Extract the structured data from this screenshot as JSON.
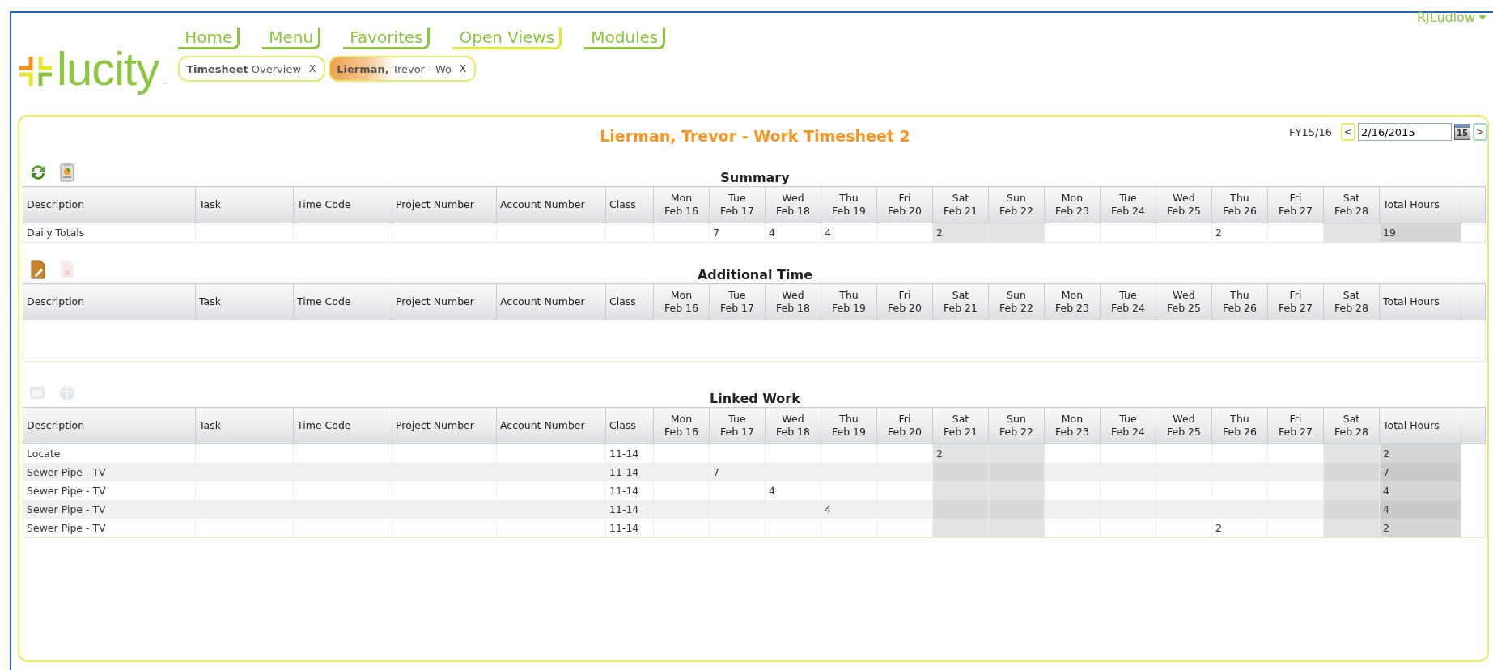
{
  "user": {
    "name": "RJLudlow"
  },
  "logo": {
    "text": "lucity",
    "mark": "™"
  },
  "nav": [
    {
      "label": "Home",
      "selected": false
    },
    {
      "label": "Menu",
      "selected": false
    },
    {
      "label": "Favorites",
      "selected": false
    },
    {
      "label": "Open Views",
      "selected": true
    },
    {
      "label": "Modules",
      "selected": false
    }
  ],
  "open_tabs": [
    {
      "label": "**Timesheet** Overview",
      "close": "X",
      "selected": false
    },
    {
      "label": "**Lierman,** Trevor  - Wo",
      "close": "X",
      "selected": true
    }
  ],
  "page": {
    "title": "Lierman, Trevor  - Work Timesheet 2",
    "fiscal_year": "FY15/16",
    "prev": "<",
    "date": "2/16/2015",
    "calendar_day": "15",
    "next": ">"
  },
  "sections": [
    {
      "title": "Summary",
      "tools": [
        {
          "kind": "refresh",
          "disabled": false
        },
        {
          "kind": "report",
          "disabled": false
        }
      ],
      "columns": [
        {
          "kind": "text",
          "label": "Description"
        },
        {
          "kind": "text",
          "label": "Task"
        },
        {
          "kind": "text",
          "label": "Time Code"
        },
        {
          "kind": "text",
          "label": "Project Number"
        },
        {
          "kind": "text",
          "label": "Account Number"
        },
        {
          "kind": "text",
          "label": "Class"
        },
        {
          "kind": "day",
          "day": "Mon",
          "date": "Feb 16",
          "weekend": false
        },
        {
          "kind": "day",
          "day": "Tue",
          "date": "Feb 17",
          "weekend": false
        },
        {
          "kind": "day",
          "day": "Wed",
          "date": "Feb 18",
          "weekend": false
        },
        {
          "kind": "day",
          "day": "Thu",
          "date": "Feb 19",
          "weekend": false
        },
        {
          "kind": "day",
          "day": "Fri",
          "date": "Feb 20",
          "weekend": false
        },
        {
          "kind": "day",
          "day": "Sat",
          "date": "Feb 21",
          "weekend": true
        },
        {
          "kind": "day",
          "day": "Sun",
          "date": "Feb 22",
          "weekend": true
        },
        {
          "kind": "day",
          "day": "Mon",
          "date": "Feb 23",
          "weekend": false
        },
        {
          "kind": "day",
          "day": "Tue",
          "date": "Feb 24",
          "weekend": false
        },
        {
          "kind": "day",
          "day": "Wed",
          "date": "Feb 25",
          "weekend": false
        },
        {
          "kind": "day",
          "day": "Thu",
          "date": "Feb 26",
          "weekend": false
        },
        {
          "kind": "day",
          "day": "Fri",
          "date": "Feb 27",
          "weekend": false
        },
        {
          "kind": "day",
          "day": "Sat",
          "date": "Feb 28",
          "weekend": true
        },
        {
          "kind": "total",
          "label": "Total Hours"
        }
      ],
      "rows": [
        {
          "cells": [
            "Daily Totals",
            null,
            null,
            null,
            null,
            null,
            null,
            "7",
            "4",
            "4",
            null,
            "2",
            null,
            null,
            null,
            null,
            "2",
            null,
            null,
            "19"
          ]
        }
      ]
    },
    {
      "title": "Additional Time",
      "tools": [
        {
          "kind": "edit",
          "disabled": false
        },
        {
          "kind": "delete",
          "disabled": true
        }
      ],
      "columns": [
        {
          "kind": "text",
          "label": "Description"
        },
        {
          "kind": "text",
          "label": "Task"
        },
        {
          "kind": "text",
          "label": "Time Code"
        },
        {
          "kind": "text",
          "label": "Project Number"
        },
        {
          "kind": "text",
          "label": "Account Number"
        },
        {
          "kind": "text",
          "label": "Class"
        },
        {
          "kind": "day",
          "day": "Mon",
          "date": "Feb 16"
        },
        {
          "kind": "day",
          "day": "Tue",
          "date": "Feb 17"
        },
        {
          "kind": "day",
          "day": "Wed",
          "date": "Feb 18"
        },
        {
          "kind": "day",
          "day": "Thu",
          "date": "Feb 19"
        },
        {
          "kind": "day",
          "day": "Fri",
          "date": "Feb 20"
        },
        {
          "kind": "day",
          "day": "Sat",
          "date": "Feb 21"
        },
        {
          "kind": "day",
          "day": "Sun",
          "date": "Feb 22"
        },
        {
          "kind": "day",
          "day": "Mon",
          "date": "Feb 23"
        },
        {
          "kind": "day",
          "day": "Tue",
          "date": "Feb 24"
        },
        {
          "kind": "day",
          "day": "Wed",
          "date": "Feb 25"
        },
        {
          "kind": "day",
          "day": "Thu",
          "date": "Feb 26"
        },
        {
          "kind": "day",
          "day": "Fri",
          "date": "Feb 27"
        },
        {
          "kind": "day",
          "day": "Sat",
          "date": "Feb 28"
        },
        {
          "kind": "total",
          "label": "Total Hours"
        }
      ]
    },
    {
      "title": "Linked Work",
      "tools": [
        {
          "kind": "open",
          "disabled": true
        },
        {
          "kind": "globe",
          "disabled": true
        }
      ],
      "columns": [
        {
          "kind": "text",
          "label": "Description"
        },
        {
          "kind": "text",
          "label": "Task"
        },
        {
          "kind": "text",
          "label": "Time Code"
        },
        {
          "kind": "text",
          "label": "Project Number"
        },
        {
          "kind": "text",
          "label": "Account Number"
        },
        {
          "kind": "text",
          "label": "Class"
        },
        {
          "kind": "day",
          "day": "Mon",
          "date": "Feb 16",
          "weekend": false
        },
        {
          "kind": "day",
          "day": "Tue",
          "date": "Feb 17",
          "weekend": false
        },
        {
          "kind": "day",
          "day": "Wed",
          "date": "Feb 18",
          "weekend": false
        },
        {
          "kind": "day",
          "day": "Thu",
          "date": "Feb 19",
          "weekend": false
        },
        {
          "kind": "day",
          "day": "Fri",
          "date": "Feb 20",
          "weekend": false
        },
        {
          "kind": "day",
          "day": "Sat",
          "date": "Feb 21",
          "weekend": true
        },
        {
          "kind": "day",
          "day": "Sun",
          "date": "Feb 22",
          "weekend": true
        },
        {
          "kind": "day",
          "day": "Mon",
          "date": "Feb 23",
          "weekend": false
        },
        {
          "kind": "day",
          "day": "Tue",
          "date": "Feb 24",
          "weekend": false
        },
        {
          "kind": "day",
          "day": "Wed",
          "date": "Feb 25",
          "weekend": false
        },
        {
          "kind": "day",
          "day": "Thu",
          "date": "Feb 26",
          "weekend": false
        },
        {
          "kind": "day",
          "day": "Fri",
          "date": "Feb 27",
          "weekend": false
        },
        {
          "kind": "day",
          "day": "Sat",
          "date": "Feb 28",
          "weekend": true
        },
        {
          "kind": "total",
          "label": "Total Hours"
        }
      ],
      "rows": [
        {
          "cells": [
            "Locate",
            null,
            null,
            null,
            null,
            "11-14",
            null,
            null,
            null,
            null,
            null,
            "2",
            null,
            null,
            null,
            null,
            null,
            null,
            null,
            "2"
          ]
        },
        {
          "cells": [
            "Sewer Pipe - TV",
            null,
            null,
            null,
            null,
            "11-14",
            null,
            "7",
            null,
            null,
            null,
            null,
            null,
            null,
            null,
            null,
            null,
            null,
            null,
            "7"
          ]
        },
        {
          "cells": [
            "Sewer Pipe - TV",
            null,
            null,
            null,
            null,
            "11-14",
            null,
            null,
            "4",
            null,
            null,
            null,
            null,
            null,
            null,
            null,
            null,
            null,
            null,
            "4"
          ]
        },
        {
          "cells": [
            "Sewer Pipe - TV",
            null,
            null,
            null,
            null,
            "11-14",
            null,
            null,
            null,
            "4",
            null,
            null,
            null,
            null,
            null,
            null,
            null,
            null,
            null,
            "4"
          ]
        },
        {
          "cells": [
            "Sewer Pipe - TV",
            null,
            null,
            null,
            null,
            "11-14",
            null,
            null,
            null,
            null,
            null,
            null,
            null,
            null,
            null,
            null,
            "2",
            null,
            null,
            "2"
          ]
        }
      ]
    }
  ]
}
